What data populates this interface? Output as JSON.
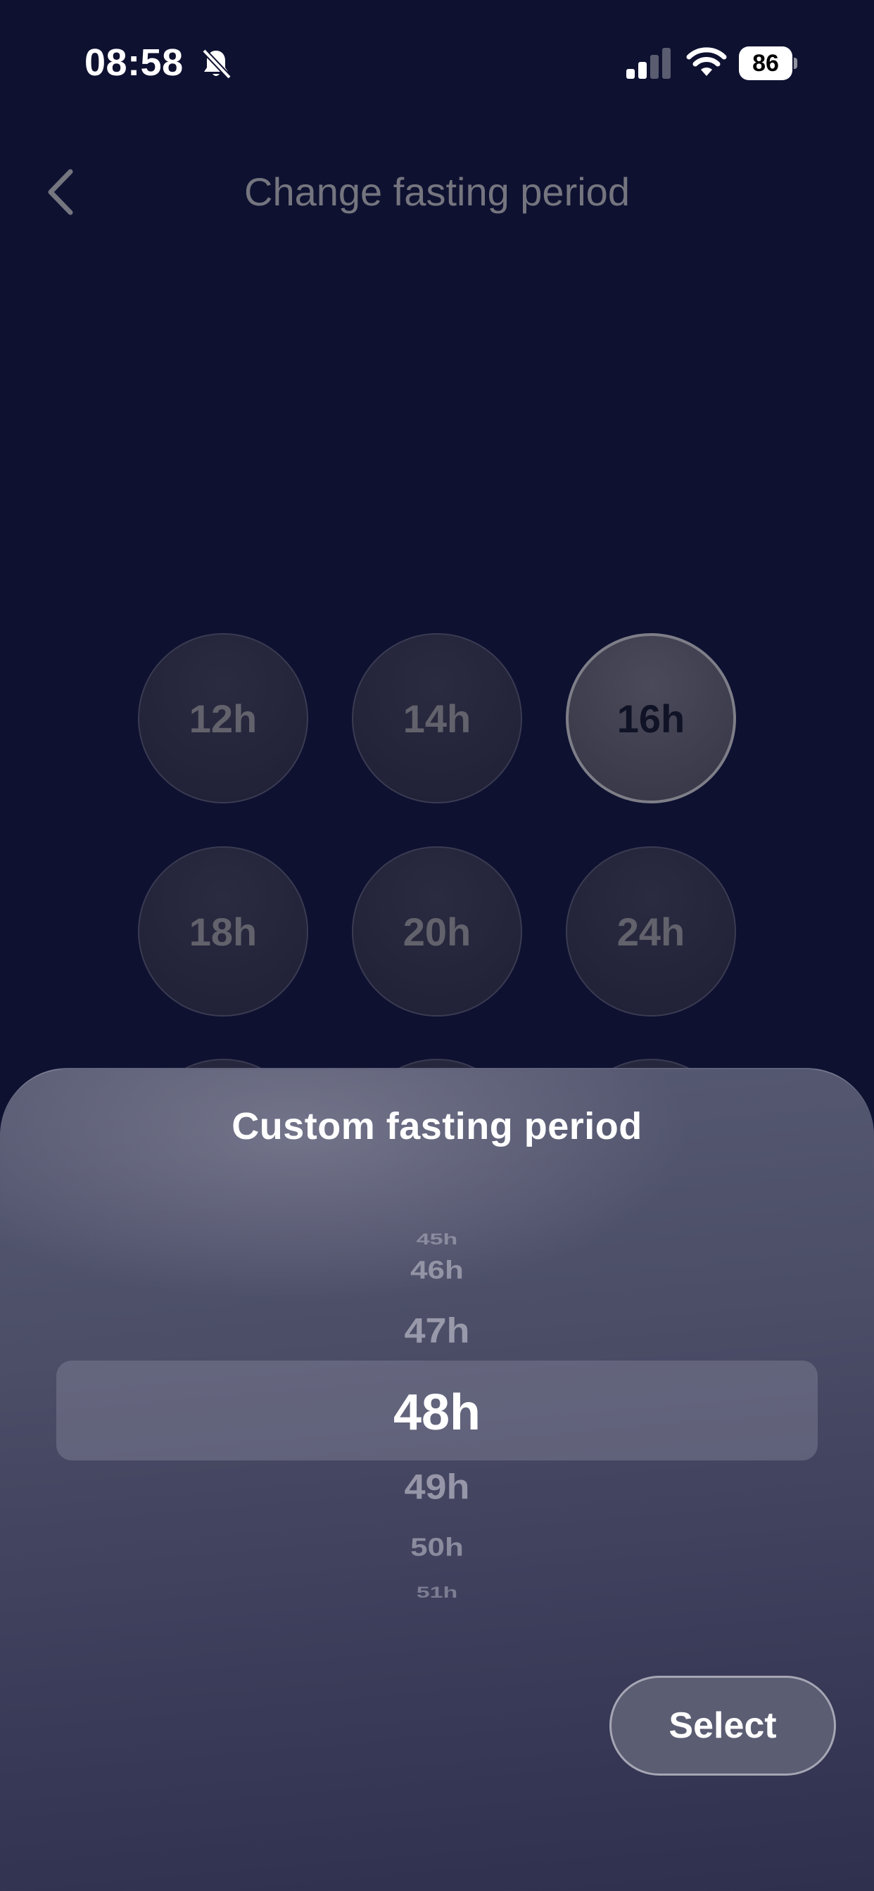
{
  "status_bar": {
    "time": "08:58",
    "battery_level": "86",
    "icons": [
      "bell-slash-icon",
      "signal-icon",
      "wifi-icon",
      "battery-icon"
    ]
  },
  "header": {
    "title": "Change fasting period",
    "back_icon": "chevron-left-icon"
  },
  "periods": [
    {
      "label": "12h",
      "selected": false
    },
    {
      "label": "14h",
      "selected": false
    },
    {
      "label": "16h",
      "selected": true
    },
    {
      "label": "18h",
      "selected": false
    },
    {
      "label": "20h",
      "selected": false
    },
    {
      "label": "24h",
      "selected": false
    }
  ],
  "sheet": {
    "title": "Custom fasting period",
    "picker": {
      "items": [
        "45h",
        "46h",
        "47h",
        "48h",
        "49h",
        "50h",
        "51h"
      ],
      "selected": "48h"
    },
    "select_label": "Select"
  }
}
